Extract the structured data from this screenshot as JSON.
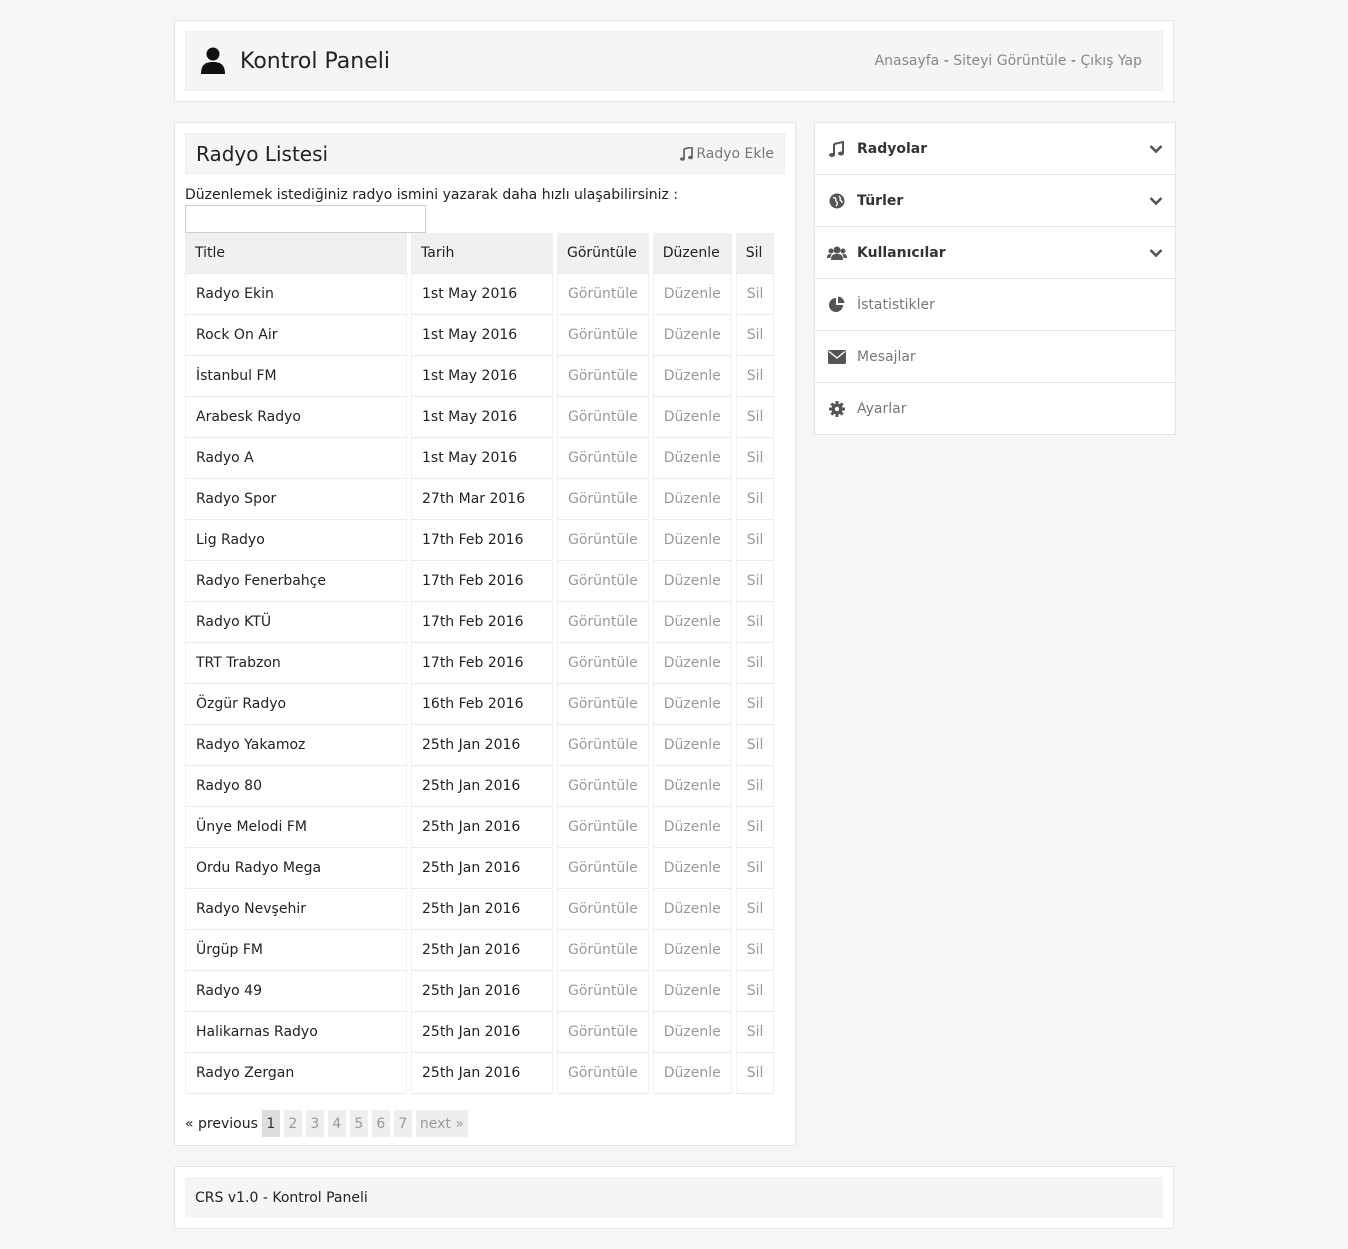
{
  "header": {
    "title": "Kontrol Paneli",
    "links": {
      "home": "Anasayfa",
      "view_site": "Siteyi Görüntüle",
      "logout": "Çıkış Yap",
      "separator": "-"
    }
  },
  "main": {
    "title": "Radyo Listesi",
    "add_label": "Radyo Ekle",
    "search_label": "Düzenlemek istediğiniz radyo ismini yazarak daha hızlı ulaşabilirsiniz :",
    "search_value": "",
    "columns": [
      "Title",
      "Tarih",
      "Görüntüle",
      "Düzenle",
      "Sil"
    ],
    "rows": [
      [
        "Radyo Ekin",
        "1st May 2016"
      ],
      [
        "Rock On Air",
        "1st May 2016"
      ],
      [
        "İstanbul FM",
        "1st May 2016"
      ],
      [
        "Arabesk Radyo",
        "1st May 2016"
      ],
      [
        "Radyo A",
        "1st May 2016"
      ],
      [
        "Radyo Spor",
        "27th Mar 2016"
      ],
      [
        "Lig Radyo",
        "17th Feb 2016"
      ],
      [
        "Radyo Fenerbahçe",
        "17th Feb 2016"
      ],
      [
        "Radyo KTÜ",
        "17th Feb 2016"
      ],
      [
        "TRT Trabzon",
        "17th Feb 2016"
      ],
      [
        "Özgür Radyo",
        "16th Feb 2016"
      ],
      [
        "Radyo Yakamoz",
        "25th Jan 2016"
      ],
      [
        "Radyo 80",
        "25th Jan 2016"
      ],
      [
        "Ünye Melodi FM",
        "25th Jan 2016"
      ],
      [
        "Ordu Radyo Mega",
        "25th Jan 2016"
      ],
      [
        "Radyo Nevşehir",
        "25th Jan 2016"
      ],
      [
        "Ürgüp FM",
        "25th Jan 2016"
      ],
      [
        "Radyo 49",
        "25th Jan 2016"
      ],
      [
        "Halikarnas Radyo",
        "25th Jan 2016"
      ],
      [
        "Radyo Zergan",
        "25th Jan 2016"
      ]
    ],
    "actions": {
      "view": "Görüntüle",
      "edit": "Düzenle",
      "delete": "Sil"
    },
    "pager": {
      "prev": "« previous",
      "pages": [
        "1",
        "2",
        "3",
        "4",
        "5",
        "6",
        "7"
      ],
      "current": "1",
      "next": "next »"
    }
  },
  "sidebar": {
    "items": [
      {
        "label": "Radyolar",
        "icon": "music-icon",
        "expandable": true
      },
      {
        "label": "Türler",
        "icon": "globe-icon",
        "expandable": true
      },
      {
        "label": "Kullanıcılar",
        "icon": "users-icon",
        "expandable": true
      },
      {
        "label": "İstatistikler",
        "icon": "pie-chart-icon",
        "expandable": false
      },
      {
        "label": "Mesajlar",
        "icon": "envelope-icon",
        "expandable": false
      },
      {
        "label": "Ayarlar",
        "icon": "gear-icon",
        "expandable": false
      }
    ]
  },
  "footer": {
    "text": "CRS v1.0 - Kontrol Paneli"
  },
  "colors": {
    "link_gray": "#888888",
    "icon_dark": "#555555",
    "panel_bg": "#f5f5f5",
    "page_bg": "#f6f6f6"
  }
}
